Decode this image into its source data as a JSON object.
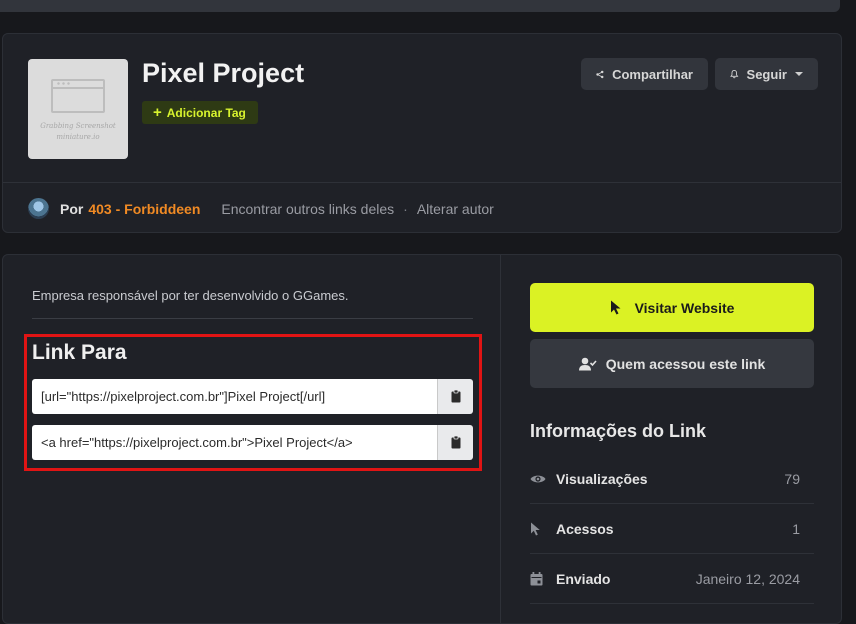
{
  "project": {
    "title": "Pixel Project",
    "add_tag_label": "Adicionar Tag",
    "thumbnail_caption_line1": "Grabbing Screenshot",
    "thumbnail_caption_line2": "miniature.io"
  },
  "header_actions": {
    "share_label": "Compartilhar",
    "follow_label": "Seguir"
  },
  "author": {
    "prefix": "Por",
    "name": "403 - Forbiddeen",
    "find_other_links": "Encontrar outros links deles",
    "separator": "·",
    "change_author": "Alterar autor"
  },
  "description": "Empresa responsável por ter desenvolvido o GGames.",
  "link_para": {
    "title": "Link Para",
    "bbcode": "[url=\"https://pixelproject.com.br\"]Pixel Project[/url]",
    "html_code": "<a href=\"https://pixelproject.com.br\">Pixel Project</a>"
  },
  "actions": {
    "visit_label": "Visitar Website",
    "who_accessed_label": "Quem acessou este link"
  },
  "info": {
    "title": "Informações do Link",
    "rows": [
      {
        "label": "Visualizações",
        "value": "79",
        "icon": "eye-icon"
      },
      {
        "label": "Acessos",
        "value": "1",
        "icon": "cursor-icon"
      },
      {
        "label": "Enviado",
        "value": "Janeiro 12, 2024",
        "icon": "calendar-icon"
      }
    ]
  },
  "colors": {
    "accent_lime": "#dbf224",
    "author_orange": "#f08a24",
    "highlight_red": "#e01414",
    "background": "#17181c",
    "card": "#1f2127"
  }
}
